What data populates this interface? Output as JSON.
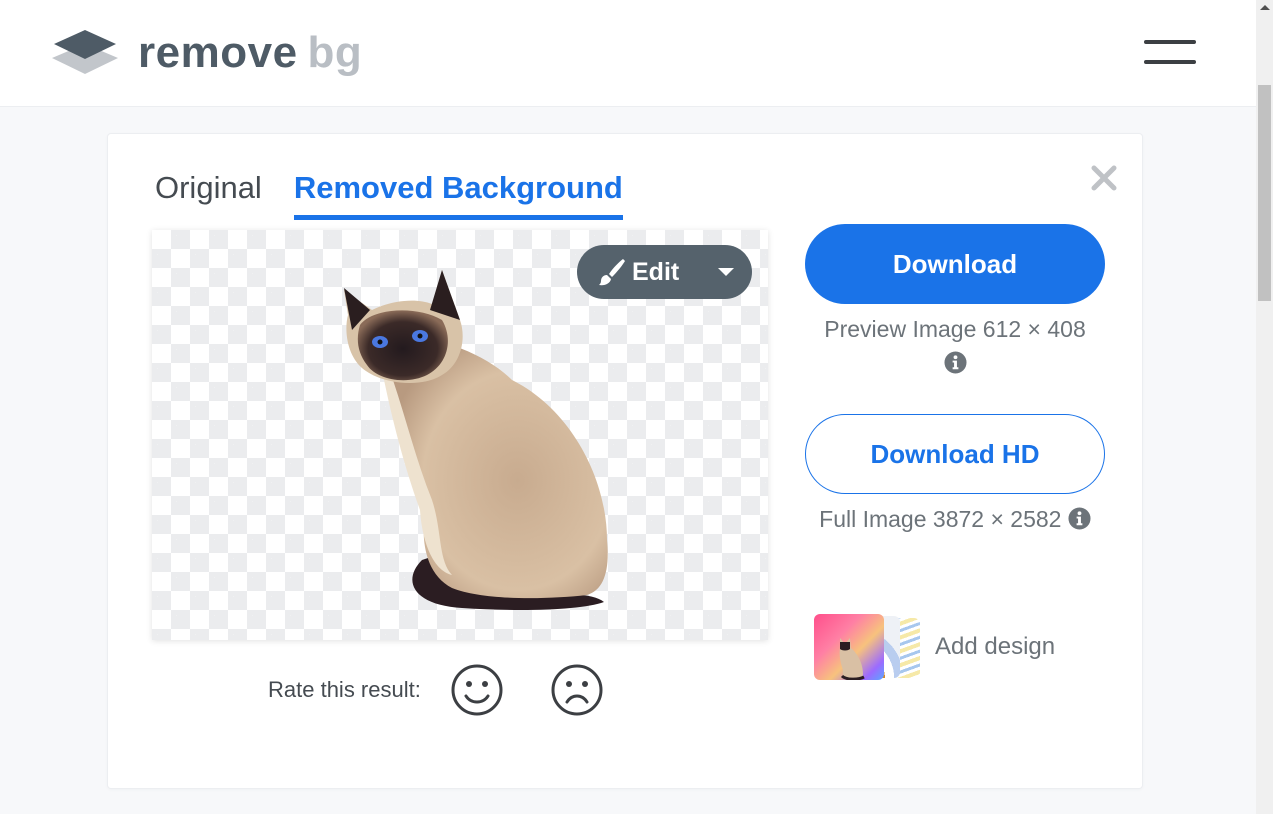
{
  "header": {
    "logo": {
      "word1": "remove",
      "word2": "bg",
      "icon": "layers-logo-icon"
    },
    "menu_icon": "hamburger-menu-icon"
  },
  "card": {
    "close_icon": "close-icon",
    "tabs": [
      {
        "label": "Original",
        "active": false
      },
      {
        "label": "Removed Background",
        "active": true
      }
    ],
    "preview": {
      "subject": "Siamese cat on transparent background",
      "edit_button": {
        "label": "Edit",
        "icon": "paintbrush-icon",
        "caret": "caret-down-icon"
      }
    },
    "rating": {
      "label": "Rate this result:",
      "positive_icon": "smiley-face-icon",
      "negative_icon": "sad-face-icon"
    },
    "download": {
      "label": "Download",
      "caption": "Preview Image 612 × 408",
      "info_icon": "info-icon"
    },
    "download_hd": {
      "label": "Download HD",
      "caption": "Full Image 3872 × 2582",
      "info_icon": "info-icon"
    },
    "add_design": {
      "label": "Add design"
    }
  },
  "colors": {
    "accent": "#1a73e8",
    "edit_button_bg": "#55626c",
    "logo_dark": "#4e5b66",
    "logo_light": "#b9bec4",
    "page_bg": "#f7f8fa"
  }
}
